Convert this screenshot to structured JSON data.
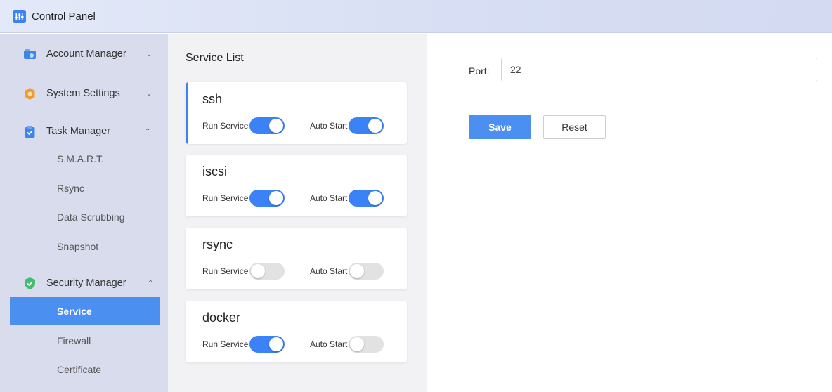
{
  "window": {
    "title": "Control Panel",
    "logo_icon": "control-panel-icon"
  },
  "sidebar": {
    "groups": [
      {
        "label": "Account Manager",
        "icon": "account-manager-icon",
        "expanded": false
      },
      {
        "label": "System Settings",
        "icon": "gear-icon",
        "expanded": false
      },
      {
        "label": "Task Manager",
        "icon": "clipboard-icon",
        "expanded": true,
        "items": [
          "S.M.A.R.T.",
          "Rsync",
          "Data Scrubbing",
          "Snapshot"
        ]
      },
      {
        "label": "Security Manager",
        "icon": "shield-icon",
        "expanded": true,
        "items": [
          "Service",
          "Firewall",
          "Certificate"
        ]
      }
    ],
    "active_item": "Service"
  },
  "service_list": {
    "title": "Service List",
    "run_label": "Run Service",
    "auto_label": "Auto Start",
    "services": [
      {
        "name": "ssh",
        "run": true,
        "auto": true,
        "selected": true
      },
      {
        "name": "iscsi",
        "run": true,
        "auto": true,
        "selected": false
      },
      {
        "name": "rsync",
        "run": false,
        "auto": false,
        "selected": false
      },
      {
        "name": "docker",
        "run": true,
        "auto": false,
        "selected": false
      }
    ]
  },
  "form": {
    "port_label": "Port:",
    "port_value": "22",
    "save_label": "Save",
    "reset_label": "Reset"
  },
  "colors": {
    "accent": "#3b82f6",
    "active_nav": "#4b8ff0",
    "sidebar_bg": "#d9dcec",
    "list_bg": "#f2f2f4"
  }
}
